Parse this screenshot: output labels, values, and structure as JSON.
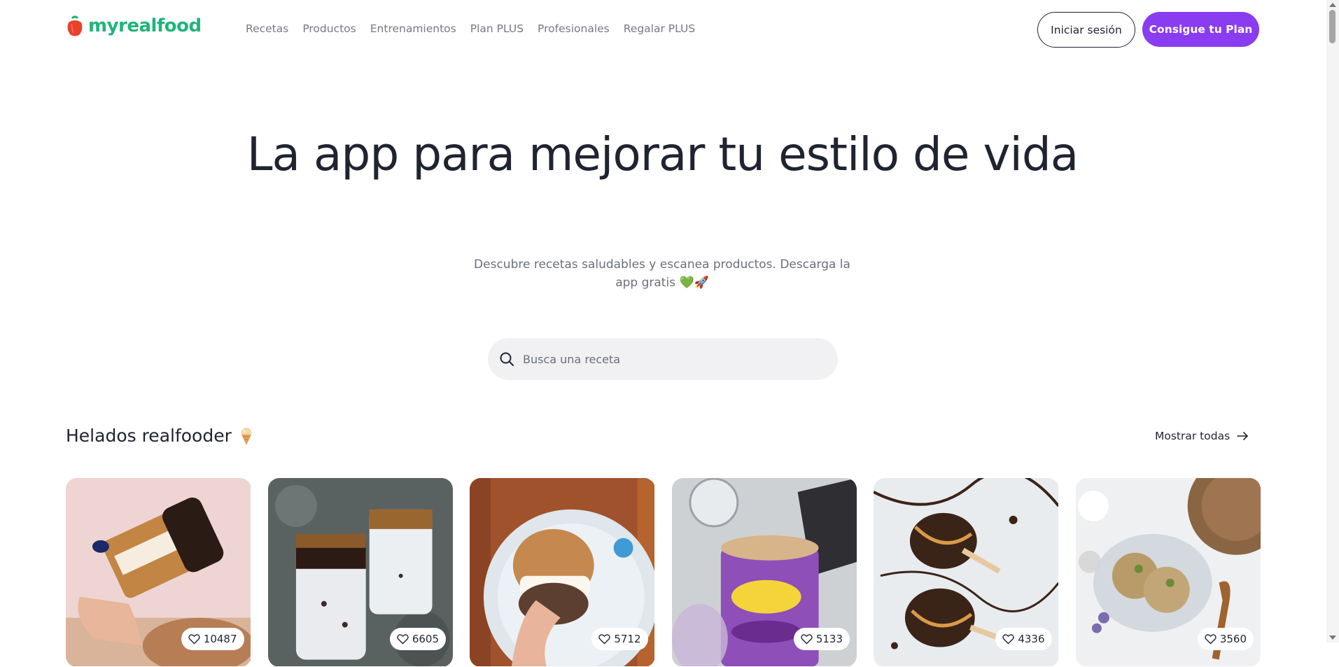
{
  "brand": {
    "name": "myrealfood",
    "color": "#1fb57a"
  },
  "nav": {
    "items": [
      {
        "label": "Recetas"
      },
      {
        "label": "Productos"
      },
      {
        "label": "Entrenamientos"
      },
      {
        "label": "Plan PLUS"
      },
      {
        "label": "Profesionales"
      },
      {
        "label": "Regalar PLUS"
      }
    ]
  },
  "header": {
    "login_label": "Iniciar sesión",
    "plan_label": "Consigue tu Plan",
    "plan_color": "#8a3cf0"
  },
  "hero": {
    "title": "La app para mejorar tu estilo de vida",
    "subtitle": "Descubre recetas saludables y escanea productos. Descarga la app gratis 💚🚀"
  },
  "search": {
    "placeholder": "Busca una receta",
    "icon": "search-icon"
  },
  "section": {
    "title": "Helados realfooder",
    "title_emoji": "ice-cream-icon",
    "show_all_label": "Mostrar todas",
    "recipes": [
      {
        "likes": "10487",
        "photo": "ice-cream-sandwich-bar"
      },
      {
        "likes": "6605",
        "photo": "granola-ice-cream-jars"
      },
      {
        "likes": "5712",
        "photo": "cookie-ice-cream-sandwich"
      },
      {
        "likes": "5133",
        "photo": "cookie-dough-ice-cream-tub"
      },
      {
        "likes": "4336",
        "photo": "chocolate-ice-pops"
      },
      {
        "likes": "3560",
        "photo": "pistachio-ice-cream-bowl"
      }
    ]
  }
}
